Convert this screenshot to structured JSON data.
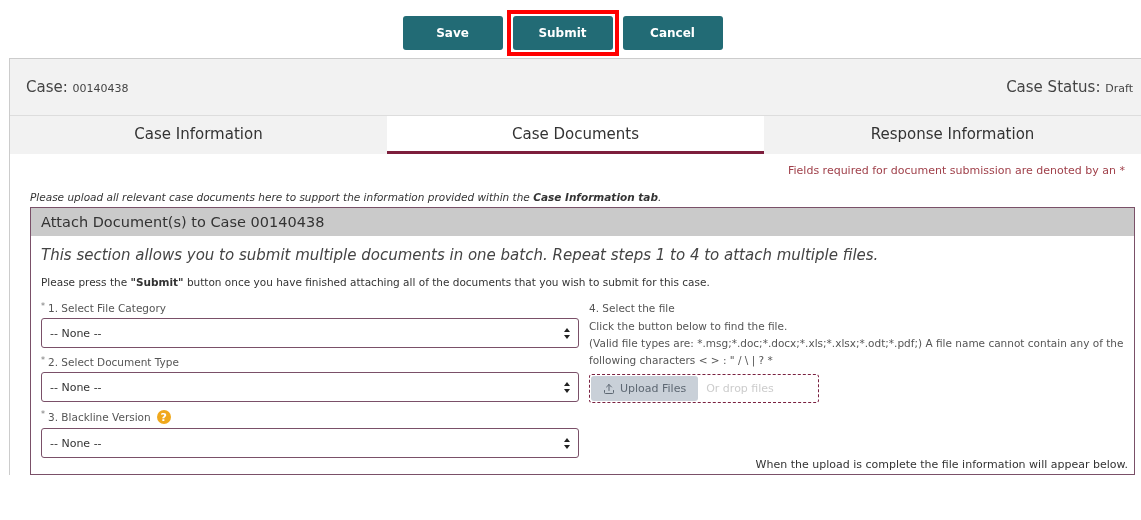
{
  "actions": [
    {
      "label": "Save",
      "highlighted": false
    },
    {
      "label": "Submit",
      "highlighted": true
    },
    {
      "label": "Cancel",
      "highlighted": false
    }
  ],
  "case": {
    "label": "Case:",
    "number": "00140438",
    "status_label": "Case Status:",
    "status": "Draft"
  },
  "tabs": [
    {
      "label": "Case Information",
      "selected": false
    },
    {
      "label": "Case Documents",
      "selected": true
    },
    {
      "label": "Response Information",
      "selected": false
    }
  ],
  "required_note": "Fields required for document submission are denoted by an *",
  "intro": "Please upload all relevant case documents here to support the information provided within the **Case Information tab**.",
  "section": {
    "title": "Attach Document(s) to Case 00140438",
    "lead": "This section allows you to submit multiple documents in one batch. Repeat steps 1 to 4 to attach multiple files.",
    "instruction": "Please press the **\"Submit\"** button once you have finished attaching all of the documents that you wish to submit for this case.",
    "fields": [
      {
        "marker": "*",
        "label": "1. Select File Category",
        "value": "-- None --"
      },
      {
        "marker": "*",
        "label": "2. Select Document Type",
        "value": "-- None --"
      },
      {
        "marker": "*",
        "label": "3. Blackline Version",
        "help_icon": "?",
        "value": "-- None --"
      }
    ],
    "file_step": {
      "label": "4. Select the file",
      "hint": "Click the button below to find the file.",
      "rules": "(Valid file types are: *.msg;*.doc;*.docx;*.xls;*.xlsx;*.odt;*.pdf;) A file name cannot contain any of the following characters < > : \" / \\ | ? *",
      "upload_button": {
        "label": "Upload Files",
        "disabled": true
      },
      "drop_text": "Or drop files"
    },
    "footer_note": "When the upload is complete the file information will appear below."
  }
}
